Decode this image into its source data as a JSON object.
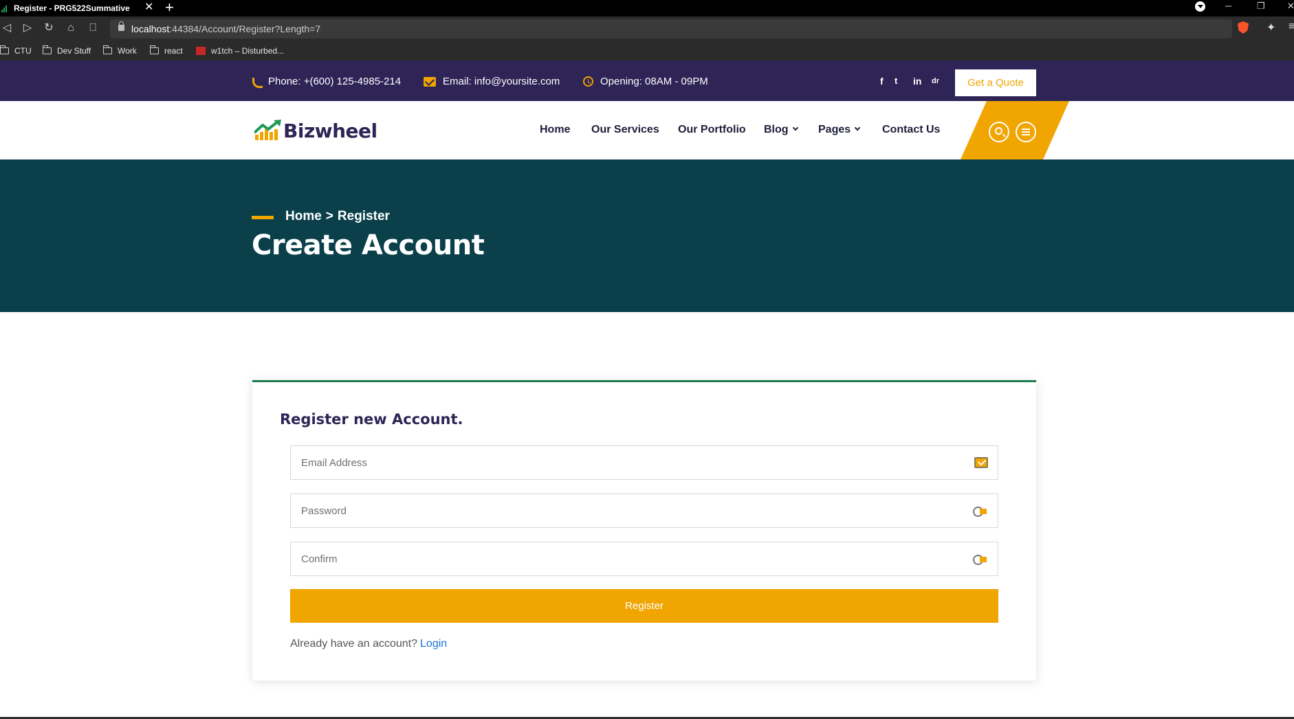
{
  "browser": {
    "tab_title": "Register - PRG522Summative",
    "tab_close": "✕",
    "new_tab": "+",
    "url_host": "localhost",
    "url_rest": ":44384/Account/Register?Length=7",
    "bookmarks": [
      "CTU",
      "Dev Stuff",
      "Work",
      "react",
      "w1tch – Disturbed..."
    ]
  },
  "topbar": {
    "phone": "Phone: +(600) 125-4985-214",
    "email": "Email: info@yoursite.com",
    "hours": "Opening: 08AM - 09PM",
    "social": [
      "f",
      "t",
      "in",
      "dr"
    ],
    "quote_button": "Get a Quote"
  },
  "header": {
    "logo_text": "Bizwheel",
    "nav": [
      "Home",
      "Our Services",
      "Our Portfolio",
      "Blog",
      "Pages",
      "Contact Us"
    ]
  },
  "hero": {
    "breadcrumb_home": "Home",
    "breadcrumb_sep": ">",
    "breadcrumb_current": "Register",
    "title": "Create Account"
  },
  "form": {
    "title": "Register new Account.",
    "email_placeholder": "Email Address",
    "password_placeholder": "Password",
    "confirm_placeholder": "Confirm",
    "submit_label": "Register",
    "login_prompt": "Already have an account?",
    "login_link": "Login"
  },
  "colors": {
    "topbar": "#2e2456",
    "accent": "#f0a500",
    "hero": "#0b404b",
    "card_border": "#1f7a4d",
    "link": "#1a6fd6"
  }
}
